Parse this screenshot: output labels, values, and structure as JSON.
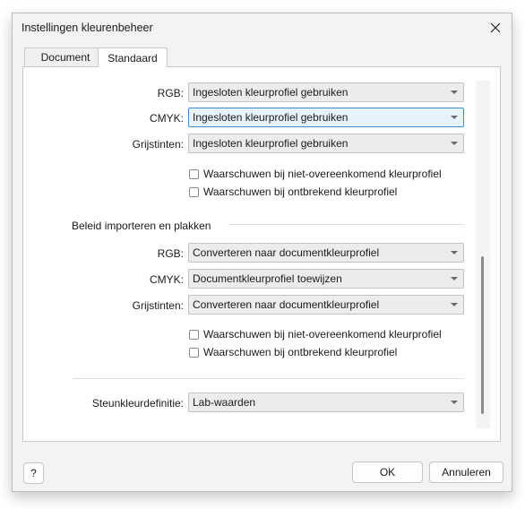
{
  "dialog": {
    "title": "Instellingen kleurenbeheer",
    "close_icon": "close-icon"
  },
  "tabs": [
    {
      "label": "Document",
      "active": false
    },
    {
      "label": "Standaard",
      "active": true
    }
  ],
  "color_policies": {
    "rgb_label": "RGB:",
    "rgb_value": "Ingesloten kleurprofiel gebruiken",
    "cmyk_label": "CMYK:",
    "cmyk_value": "Ingesloten kleurprofiel gebruiken",
    "gray_label": "Grijstinten:",
    "gray_value": "Ingesloten kleurprofiel gebruiken",
    "warn_mismatch": "Waarschuwen bij niet-overeenkomend kleurprofiel",
    "warn_mismatch_checked": false,
    "warn_missing": "Waarschuwen bij ontbrekend kleurprofiel",
    "warn_missing_checked": false
  },
  "import_policies": {
    "section_title": "Beleid importeren en plakken",
    "rgb_label": "RGB:",
    "rgb_value": "Converteren naar documentkleurprofiel",
    "cmyk_label": "CMYK:",
    "cmyk_value": "Documentkleurprofiel toewijzen",
    "gray_label": "Grijstinten:",
    "gray_value": "Converteren naar documentkleurprofiel",
    "warn_mismatch": "Waarschuwen bij niet-overeenkomend kleurprofiel",
    "warn_mismatch_checked": false,
    "warn_missing": "Waarschuwen bij ontbrekend kleurprofiel",
    "warn_missing_checked": false
  },
  "spot": {
    "label": "Steunkleurdefinitie:",
    "value": "Lab-waarden"
  },
  "footer": {
    "help_label": "?",
    "ok_label": "OK",
    "cancel_label": "Annuleren"
  },
  "colors": {
    "focus_border": "#3c8ad6",
    "focus_fill": "#e6f3fc",
    "dialog_bg": "#f3f3f3"
  }
}
